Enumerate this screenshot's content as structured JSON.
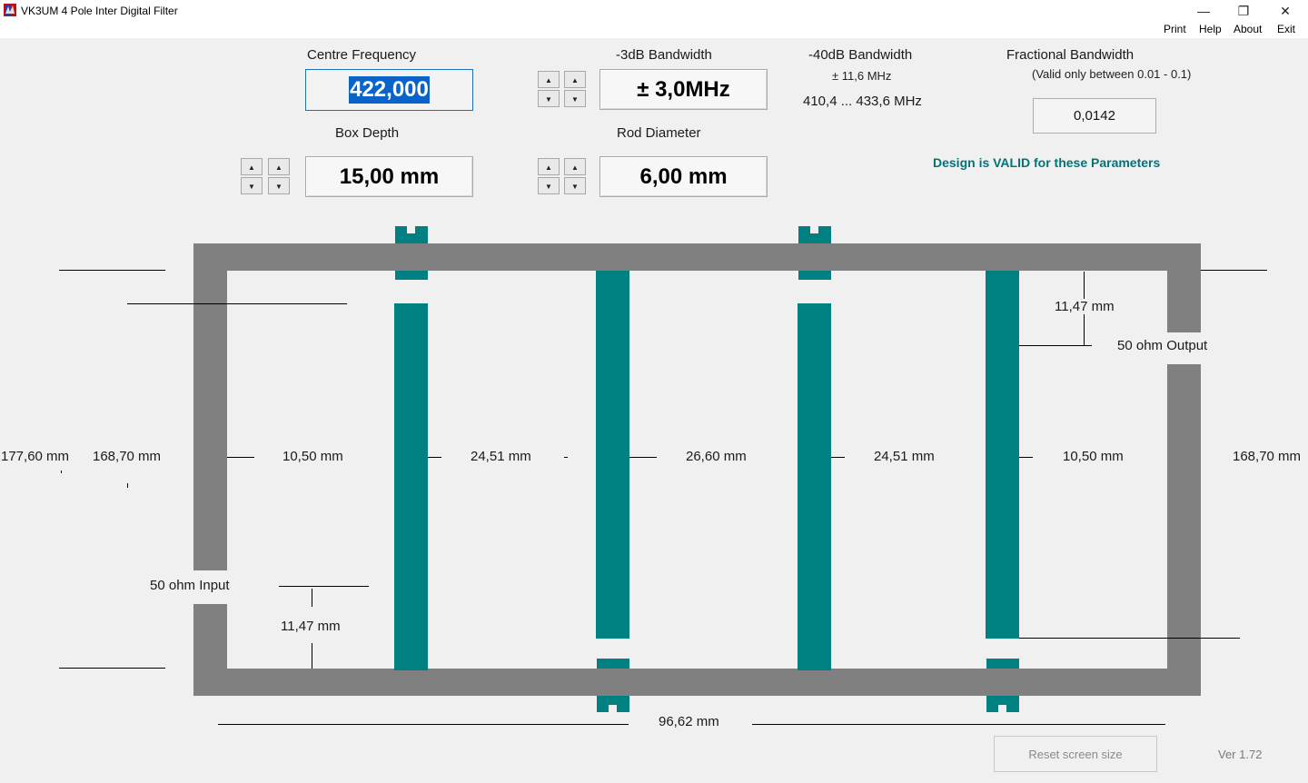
{
  "window": {
    "title": "VK3UM 4 Pole Inter Digital Filter",
    "minimize_glyph": "—",
    "restore_glyph": "❐",
    "close_glyph": "✕"
  },
  "menu": {
    "print": "Print",
    "help": "Help",
    "about": "About",
    "exit": "Exit"
  },
  "inputs": {
    "centre_frequency": {
      "label": "Centre Frequency",
      "value": "422,000"
    },
    "bandwidth_3db": {
      "label": "-3dB Bandwidth",
      "value": "± 3,0MHz"
    },
    "box_depth": {
      "label": "Box Depth",
      "value": "15,00 mm"
    },
    "rod_diameter": {
      "label": "Rod Diameter",
      "value": "6,00 mm"
    }
  },
  "spinner": {
    "up_glyph": "▲",
    "down_glyph": "▼"
  },
  "bandwidth_40db": {
    "label": "-40dB Bandwidth",
    "value": "± 11,6 MHz",
    "range": "410,4 ... 433,6 MHz"
  },
  "fractional_bandwidth": {
    "label": "Fractional Bandwidth",
    "note": "(Valid only between 0.01 - 0.1)",
    "value": "0,0142"
  },
  "status": {
    "text": "Design is VALID for these Parameters",
    "color": "#007478"
  },
  "diagram": {
    "outer_height": "177,60 mm",
    "inner_height_left": "168,70 mm",
    "inner_height_right": "168,70 mm",
    "spacing_1": "10,50 mm",
    "spacing_2": "24,51 mm",
    "spacing_3": "26,60 mm",
    "spacing_4": "24,51 mm",
    "spacing_5": "10,50 mm",
    "tap_output": "11,47 mm",
    "tap_input": "11,47 mm",
    "output_label": "50 ohm Output",
    "input_label": "50 ohm  Input",
    "box_width": "96,62 mm",
    "box_color": "#808080",
    "rod_color": "#008080"
  },
  "footer": {
    "reset_label": "Reset screen size",
    "version": "Ver 1.72"
  }
}
